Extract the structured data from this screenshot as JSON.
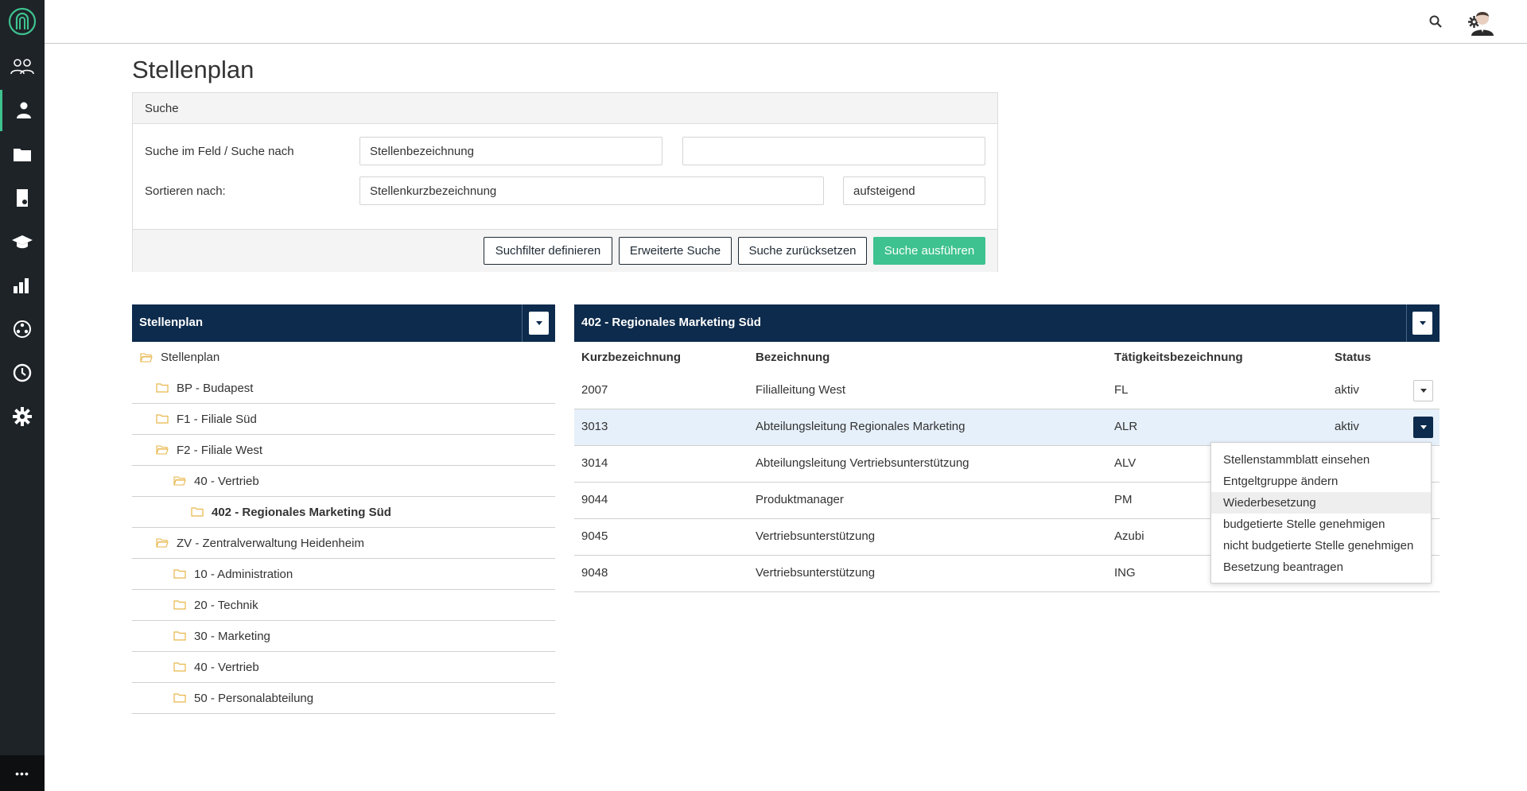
{
  "colors": {
    "accent": "#3ec28f",
    "navy": "#0d2b4c",
    "sidebar": "#1e2328"
  },
  "sidebar": {
    "items": [
      {
        "name": "team-icon"
      },
      {
        "name": "org-chart-icon",
        "active": true
      },
      {
        "name": "folder-icon"
      },
      {
        "name": "document-search-icon"
      },
      {
        "name": "graduation-cap-icon"
      },
      {
        "name": "bar-chart-icon"
      },
      {
        "name": "network-icon"
      },
      {
        "name": "clock-icon"
      },
      {
        "name": "gear-icon"
      }
    ],
    "more": "•••"
  },
  "page": {
    "title": "Stellenplan"
  },
  "search": {
    "header": "Suche",
    "field_label": "Suche im Feld / Suche nach",
    "field_value": "Stellenbezeichnung",
    "query_value": "",
    "sort_label": "Sortieren nach:",
    "sort_value": "Stellenkurzbezeichnung",
    "order_value": "aufsteigend",
    "buttons": {
      "define_filter": "Suchfilter definieren",
      "advanced": "Erweiterte Suche",
      "reset": "Suche zurücksetzen",
      "execute": "Suche ausführen"
    }
  },
  "tree": {
    "title": "Stellenplan",
    "nodes": [
      {
        "label": "Stellenplan",
        "open": true
      },
      {
        "label": "BP - Budapest"
      },
      {
        "label": "F1 - Filiale Süd"
      },
      {
        "label": "F2 - Filiale West",
        "open": true
      },
      {
        "label": "40 - Vertrieb",
        "open": true
      },
      {
        "label": "402 - Regionales Marketing Süd"
      },
      {
        "label": "ZV - Zentralverwaltung Heidenheim",
        "open": true
      },
      {
        "label": "10 - Administration"
      },
      {
        "label": "20 - Technik"
      },
      {
        "label": "30 - Marketing"
      },
      {
        "label": "40 - Vertrieb"
      },
      {
        "label": "50 - Personalabteilung"
      }
    ]
  },
  "table": {
    "title": "402 - Regionales Marketing Süd",
    "columns": [
      "Kurzbezeichnung",
      "Bezeichnung",
      "Tätigkeitsbezeichnung",
      "Status"
    ],
    "rows": [
      {
        "kurz": "2007",
        "bez": "Filialleitung West",
        "taet": "FL",
        "status": "aktiv"
      },
      {
        "kurz": "3013",
        "bez": "Abteilungsleitung Regionales Marketing",
        "taet": "ALR",
        "status": "aktiv"
      },
      {
        "kurz": "3014",
        "bez": "Abteilungsleitung Vertriebsunterstützung",
        "taet": "ALV",
        "status": ""
      },
      {
        "kurz": "9044",
        "bez": "Produktmanager",
        "taet": "PM",
        "status": ""
      },
      {
        "kurz": "9045",
        "bez": "Vertriebsunterstützung",
        "taet": "Azubi",
        "status": ""
      },
      {
        "kurz": "9048",
        "bez": "Vertriebsunterstützung",
        "taet": "ING",
        "status": ""
      }
    ]
  },
  "dropdown": {
    "items": [
      "Stellenstammblatt einsehen",
      "Entgeltgruppe ändern",
      "Wiederbesetzung",
      "budgetierte Stelle genehmigen",
      "nicht budgetierte Stelle genehmigen",
      "Besetzung beantragen"
    ]
  }
}
